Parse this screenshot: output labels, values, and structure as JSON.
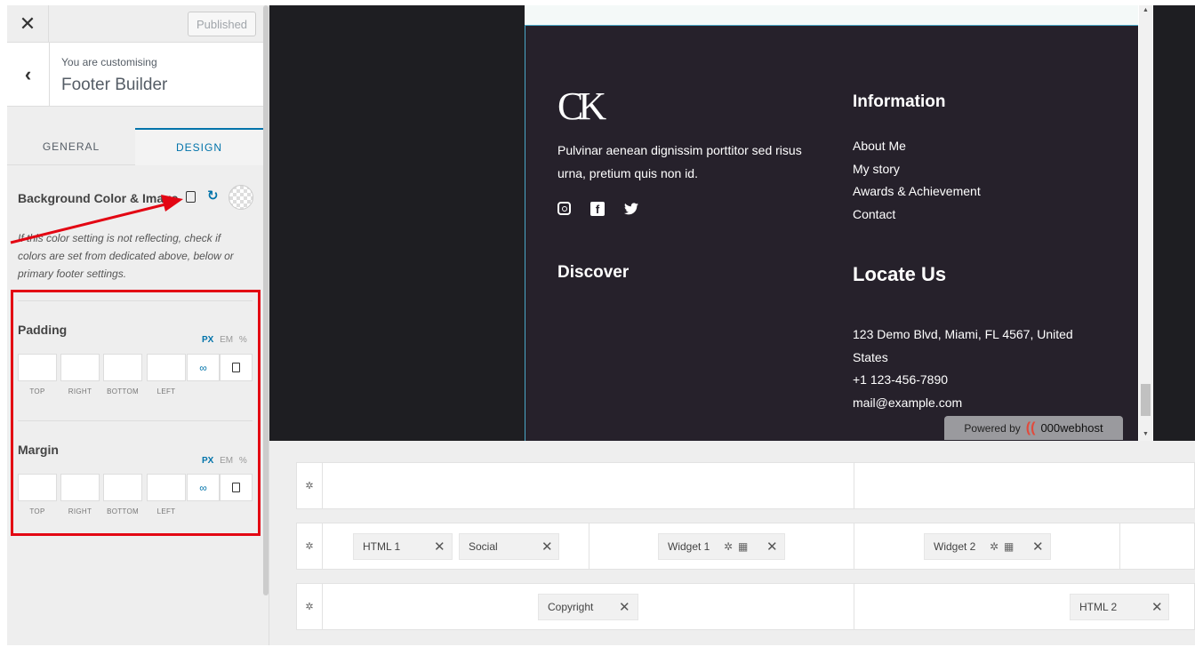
{
  "sidebar": {
    "published_label": "Published",
    "customising_label": "You are customising",
    "section_title": "Footer Builder",
    "tabs": {
      "general": "GENERAL",
      "design": "DESIGN"
    },
    "background_label": "Background Color & Image",
    "note": "If this color setting is not reflecting, check if colors are set from dedicated above, below or primary footer settings.",
    "padding": {
      "label": "Padding",
      "units": [
        "PX",
        "EM",
        "%"
      ],
      "sides": [
        "TOP",
        "RIGHT",
        "BOTTOM",
        "LEFT"
      ]
    },
    "margin": {
      "label": "Margin",
      "units": [
        "PX",
        "EM",
        "%"
      ],
      "sides": [
        "TOP",
        "RIGHT",
        "BOTTOM",
        "LEFT"
      ]
    }
  },
  "preview": {
    "logo": "CK",
    "about": "Pulvinar aenean dignissim porttitor sed risus urna, pretium quis non id.",
    "info_heading": "Information",
    "info_links": [
      "About Me",
      "My story",
      "Awards & Achievement",
      "Contact"
    ],
    "discover_heading": "Discover",
    "locate_heading": "Locate Us",
    "address_lines": [
      "123 Demo Blvd, Miami, FL 4567, United States",
      "+1 123-456-7890",
      "mail@example.com"
    ],
    "powered_label": "Powered by",
    "powered_brand": "000webhost"
  },
  "builder": {
    "row2": {
      "items": [
        {
          "label": "HTML 1"
        },
        {
          "label": "Social"
        },
        {
          "label": "Widget 1"
        },
        {
          "label": "Widget 2"
        }
      ]
    },
    "row3": {
      "items": [
        {
          "label": "Copyright"
        },
        {
          "label": "HTML 2"
        }
      ]
    }
  },
  "colors": {
    "accent": "#0073aa",
    "footer_bg": "#26212b",
    "annotation_red": "#e30613"
  }
}
